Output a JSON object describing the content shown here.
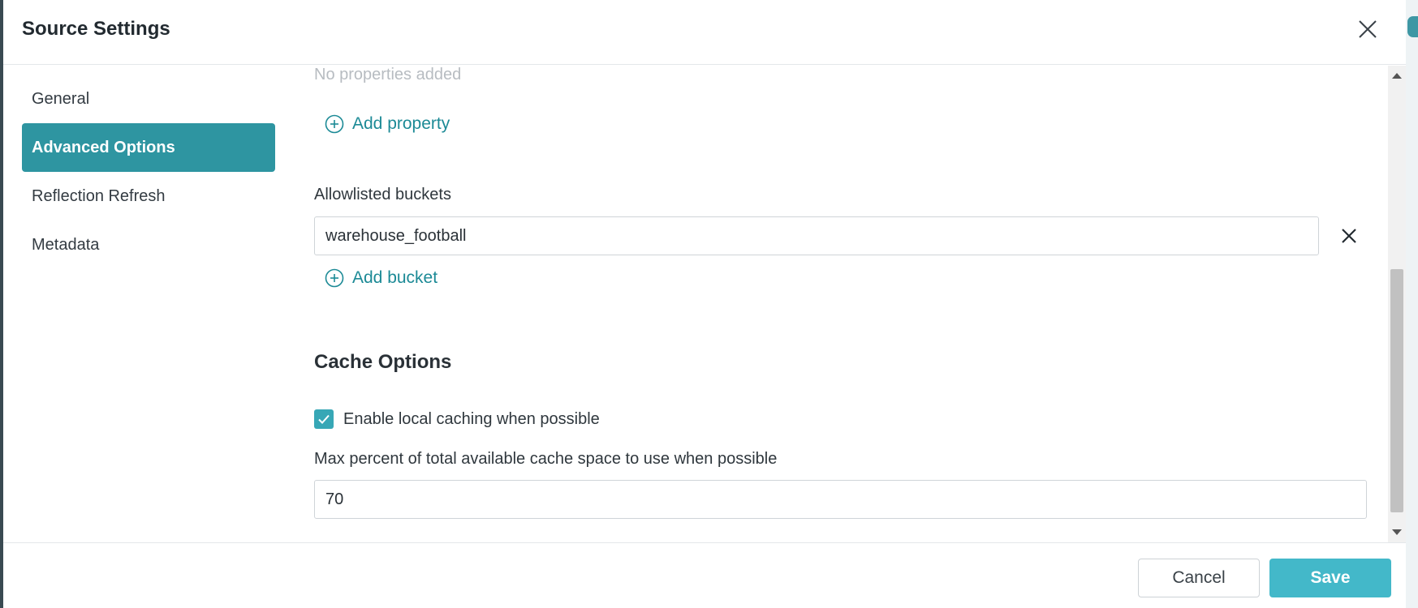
{
  "dialog": {
    "title": "Source Settings"
  },
  "sidebar": {
    "items": [
      {
        "label": "General"
      },
      {
        "label": "Advanced Options"
      },
      {
        "label": "Reflection Refresh"
      },
      {
        "label": "Metadata"
      }
    ],
    "active_index": 1
  },
  "properties": {
    "empty_text": "No properties added",
    "add_label": "Add property"
  },
  "buckets": {
    "label": "Allowlisted buckets",
    "items": [
      {
        "value": "warehouse_football"
      }
    ],
    "add_label": "Add bucket"
  },
  "cache": {
    "section_title": "Cache Options",
    "enable_label": "Enable local caching when possible",
    "enable_checked": true,
    "max_percent_label": "Max percent of total available cache space to use when possible",
    "max_percent_value": "70"
  },
  "footer": {
    "cancel_label": "Cancel",
    "save_label": "Save"
  },
  "colors": {
    "accent": "#2e95a1",
    "link": "#1c8a96",
    "save": "#43b8c9",
    "checkbox": "#37a7b6"
  }
}
